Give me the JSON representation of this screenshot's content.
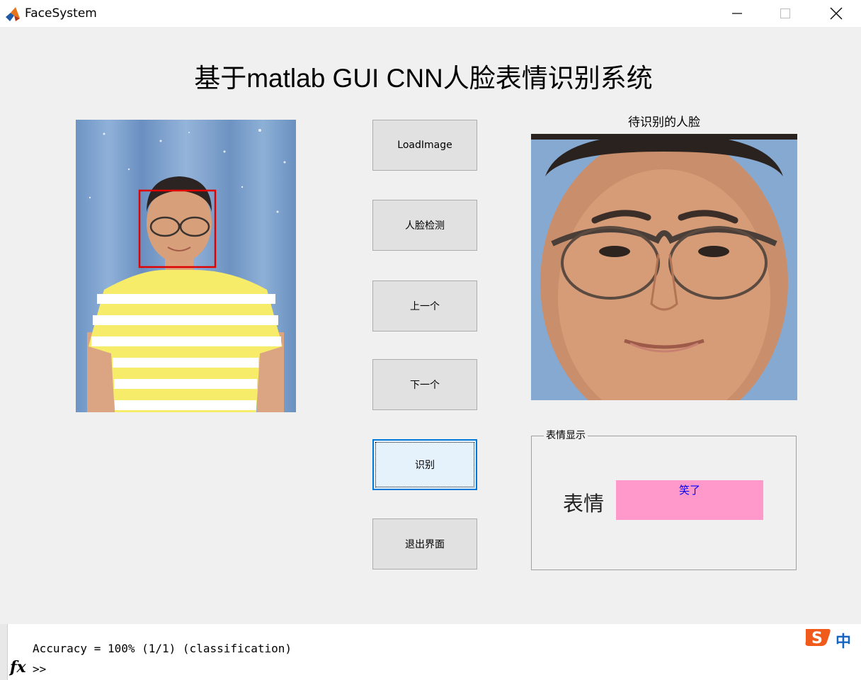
{
  "window": {
    "title": "FaceSystem",
    "app_icon": "matlab-icon",
    "controls": [
      "minimize-icon",
      "maximize-icon",
      "close-icon"
    ]
  },
  "figure": {
    "title": "基于matlab GUI CNN人脸表情识别系统",
    "right_axes_title": "待识别的人脸",
    "buttons": {
      "load": "LoadImage",
      "detect": "人脸检测",
      "prev": "上一个",
      "next": "下一个",
      "recognize": "识别",
      "exit": "退出界面"
    },
    "panel": {
      "title": "表情显示",
      "label": "表情",
      "value": "笑了",
      "value_bg": "#ff99cc",
      "value_color": "#0000ff"
    },
    "images": {
      "source_photo": "person-photo",
      "face_crop": "face-crop",
      "detection_box_color": "#e00000"
    }
  },
  "command_window": {
    "output": "Accuracy = 100% (1/1) (classification)",
    "prompt": ">>",
    "fx": "fx",
    "ime_label": "中"
  }
}
